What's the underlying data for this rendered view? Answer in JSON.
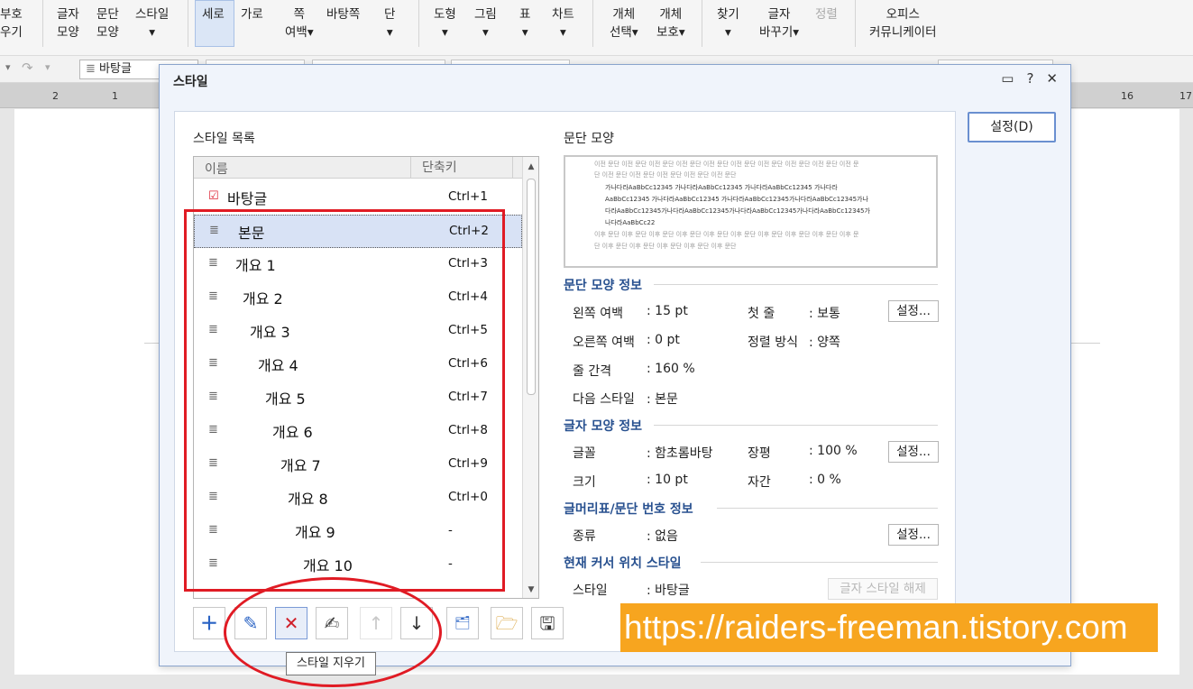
{
  "ribbon": {
    "items": [
      {
        "l1": "부호",
        "l2": "우기"
      },
      {
        "l1": "글자",
        "l2": "모양"
      },
      {
        "l1": "문단",
        "l2": "모양"
      },
      {
        "l1": "스타일",
        "l2": "▾"
      },
      {
        "l1": "세로",
        "l2": ""
      },
      {
        "l1": "가로",
        "l2": ""
      },
      {
        "l1": "쪽",
        "l2": "여백▾"
      },
      {
        "l1": "바탕쪽",
        "l2": ""
      },
      {
        "l1": "단",
        "l2": "▾"
      },
      {
        "l1": "도형",
        "l2": "▾"
      },
      {
        "l1": "그림",
        "l2": "▾"
      },
      {
        "l1": "표",
        "l2": "▾"
      },
      {
        "l1": "차트",
        "l2": "▾"
      },
      {
        "l1": "개체",
        "l2": "선택▾"
      },
      {
        "l1": "개체",
        "l2": "보호▾"
      },
      {
        "l1": "찾기",
        "l2": "▾"
      },
      {
        "l1": "글자",
        "l2": "바꾸기▾"
      },
      {
        "l1": "정렬",
        "l2": ""
      },
      {
        "l1": "오피스",
        "l2": "커뮤니케이터"
      }
    ]
  },
  "toolbar": {
    "style_value": "바탕글"
  },
  "ruler": {
    "n1": "2",
    "n2": "1",
    "n3": "16",
    "n4": "17"
  },
  "dialog": {
    "title": "스타일",
    "help": "?",
    "close": "✕",
    "setting_button": "설정(D)",
    "list_title": "스타일 목록",
    "col_name": "이름",
    "col_shortcut": "단축키",
    "styles": [
      {
        "name": "바탕글",
        "shortcut": "Ctrl+1"
      },
      {
        "name": "본문",
        "shortcut": "Ctrl+2"
      },
      {
        "name": "개요 1",
        "shortcut": "Ctrl+3"
      },
      {
        "name": "개요 2",
        "shortcut": "Ctrl+4"
      },
      {
        "name": "개요 3",
        "shortcut": "Ctrl+5"
      },
      {
        "name": "개요 4",
        "shortcut": "Ctrl+6"
      },
      {
        "name": "개요 5",
        "shortcut": "Ctrl+7"
      },
      {
        "name": "개요 6",
        "shortcut": "Ctrl+8"
      },
      {
        "name": "개요 7",
        "shortcut": "Ctrl+9"
      },
      {
        "name": "개요 8",
        "shortcut": "Ctrl+0"
      },
      {
        "name": "개요 9",
        "shortcut": "-"
      },
      {
        "name": "개요 10",
        "shortcut": "-"
      }
    ],
    "preview_title": "문단 모양",
    "preview": {
      "prev1": "이전 문단 이전 문단 이전 문단 이전 문단 이전 문단 이전 문단 이전 문단 이전 문단 이전 문단 이전 문",
      "prev2": "단 이전 문단 이전 문단 이전 문단 이전 문단 이전 문단",
      "s1": "가나다라AaBbCc12345      가나다라AaBbCc12345      가나다라AaBbCc12345      가나다라",
      "s2": "AaBbCc12345    가나다라AaBbCc12345    가나다라AaBbCc12345가나다라AaBbCc12345가나",
      "s3": "다라AaBbCc12345가나다라AaBbCc12345가나다라AaBbCc12345가나다라AaBbCc12345가",
      "s4": "나다라AaBbCc22",
      "next1": "이후 문단 이후 문단 이후 문단 이후 문단 이후 문단 이후 문단 이후 문단 이후 문단 이후 문단 이후 문",
      "next2": "단 이후 문단 이후 문단 이후 문단 이후 문단 이후 문단"
    },
    "para_info": {
      "title": "문단 모양 정보",
      "left_margin_k": "왼쪽 여백",
      "left_margin_v": ": 15 pt",
      "first_line_k": "첫 줄",
      "first_line_v": ": 보통",
      "right_margin_k": "오른쪽 여백",
      "right_margin_v": ": 0 pt",
      "align_k": "정렬 방식",
      "align_v": ": 양쪽",
      "line_k": "줄 간격",
      "line_v": ": 160 %",
      "next_k": "다음 스타일",
      "next_v": ": 본문",
      "btn": "설정..."
    },
    "char_info": {
      "title": "글자 모양 정보",
      "font_k": "글꼴",
      "font_v": ": 함초롬바탕",
      "ratio_k": "장평",
      "ratio_v": ": 100 %",
      "size_k": "크기",
      "size_v": ": 10 pt",
      "spacing_k": "자간",
      "spacing_v": ": 0 %",
      "btn": "설정..."
    },
    "bullet_info": {
      "title": "글머리표/문단 번호 정보",
      "type_k": "종류",
      "type_v": ": 없음",
      "btn": "설정..."
    },
    "cursor_info": {
      "title": "현재 커서 위치 스타일",
      "style_k": "스타일",
      "style_v": ": 바탕글",
      "btn": "글자 스타일 해제"
    },
    "tooltip": "스타일 지우기"
  },
  "watermark": "https://raiders-freeman.tistory.com",
  "colors": {
    "accent": "#27508f",
    "annotation": "#e01b24",
    "watermark_bg": "#f7a51f"
  }
}
